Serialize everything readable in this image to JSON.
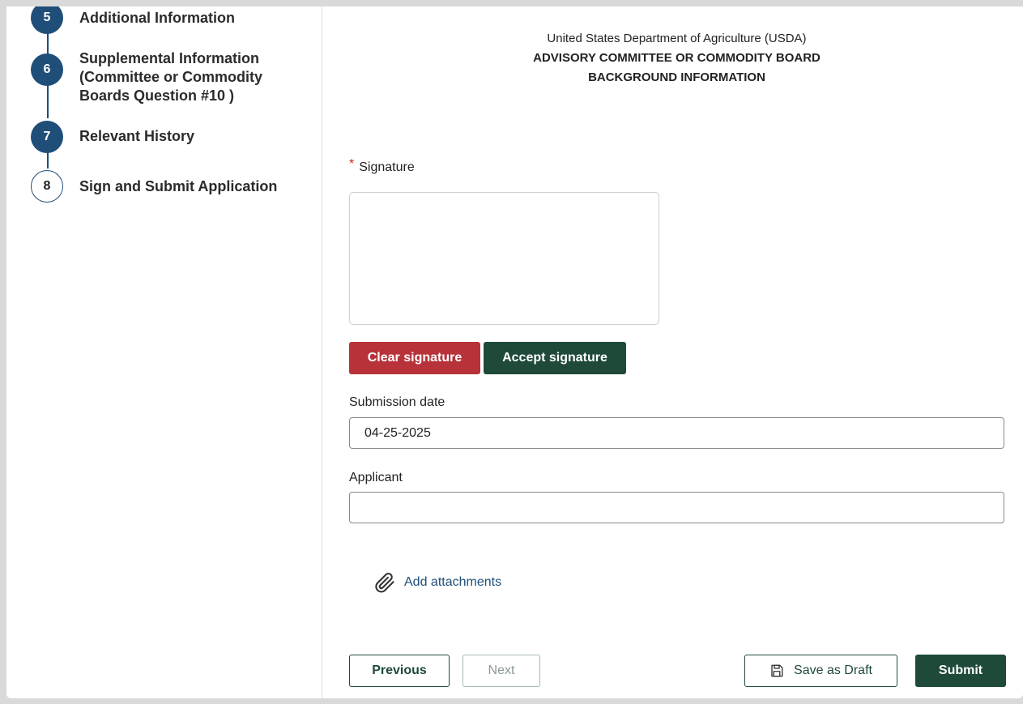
{
  "steps": [
    {
      "number": "5",
      "label": "Additional Information",
      "state": "complete"
    },
    {
      "number": "6",
      "label": "Supplemental Information (Committee or Commodity Boards Question #10 )",
      "state": "complete"
    },
    {
      "number": "7",
      "label": "Relevant History",
      "state": "complete"
    },
    {
      "number": "8",
      "label": "Sign and Submit Application",
      "state": "current"
    }
  ],
  "header": {
    "org": "United States Department of Agriculture (USDA)",
    "title_line1": "ADVISORY COMMITTEE OR COMMODITY BOARD",
    "title_line2": "BACKGROUND INFORMATION"
  },
  "signature": {
    "required_mark": "*",
    "label": "Signature",
    "clear_label": "Clear signature",
    "accept_label": "Accept signature"
  },
  "submission_date": {
    "label": "Submission date",
    "value": "04-25-2025"
  },
  "applicant": {
    "label": "Applicant",
    "value": ""
  },
  "attachments": {
    "label": "Add attachments",
    "icon": "paperclip-icon"
  },
  "footer": {
    "previous_label": "Previous",
    "next_label": "Next",
    "draft_label": "Save as Draft",
    "draft_icon": "floppy-disk-icon",
    "submit_label": "Submit"
  },
  "colors": {
    "step_blue": "#1f4e79",
    "dark_green": "#1f4a3a",
    "clear_red": "#b8323a",
    "required_red": "#c62828"
  }
}
